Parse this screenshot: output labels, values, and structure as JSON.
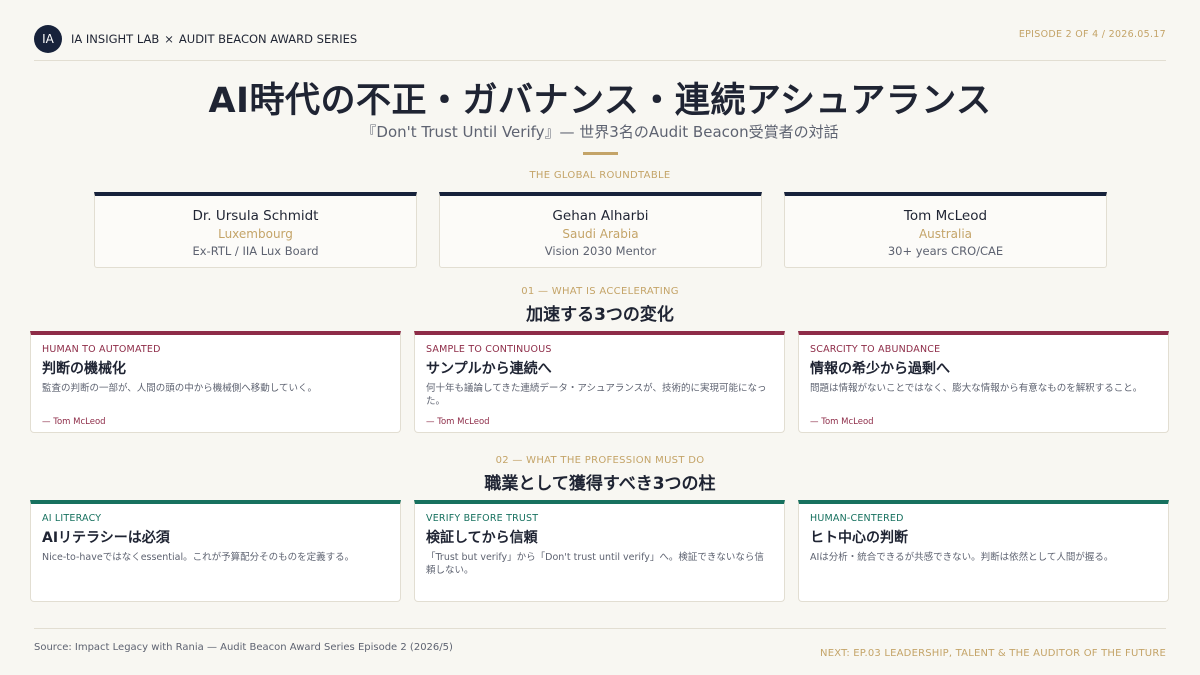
{
  "header": {
    "logo_text": "IA",
    "brand_left": "IA INSIGHT LAB",
    "separator": "×",
    "brand_right": "AUDIT BEACON AWARD SERIES",
    "episode": "EPISODE 2 OF 4  /  2026.05.17"
  },
  "title": {
    "main": "AI時代の不正・ガバナンス・連続アシュアランス",
    "subtitle": "『Don't Trust Until Verify』— 世界3名のAudit Beacon受賞者の対話"
  },
  "roundtable": {
    "eyebrow": "THE GLOBAL ROUNDTABLE",
    "panelists": [
      {
        "name": "Dr. Ursula Schmidt",
        "country": "Luxembourg",
        "role": "Ex-RTL / IIA Lux Board"
      },
      {
        "name": "Gehan Alharbi",
        "country": "Saudi Arabia",
        "role": "Vision 2030 Mentor"
      },
      {
        "name": "Tom McLeod",
        "country": "Australia",
        "role": "30+ years CRO/CAE"
      }
    ]
  },
  "shifts": {
    "eyebrow": "01 — WHAT IS ACCELERATING",
    "heading": "加速する3つの変化",
    "cards": [
      {
        "label": "HUMAN  TO  AUTOMATED",
        "title": "判断の機械化",
        "body": "監査の判断の一部が、人間の頭の中から機械側へ移動していく。",
        "quote": "— Tom McLeod"
      },
      {
        "label": "SAMPLE  TO  CONTINUOUS",
        "title": "サンプルから連続へ",
        "body": "何十年も議論してきた連続データ・アシュアランスが、技術的に実現可能になった。",
        "quote": "— Tom McLeod"
      },
      {
        "label": "SCARCITY  TO  ABUNDANCE",
        "title": "情報の希少から過剰へ",
        "body": "問題は情報がないことではなく、膨大な情報から有意なものを解釈すること。",
        "quote": "— Tom McLeod"
      }
    ]
  },
  "pillars": {
    "eyebrow": "02 — WHAT THE PROFESSION MUST DO",
    "heading": "職業として獲得すべき3つの柱",
    "cards": [
      {
        "label": "AI LITERACY",
        "title": "AIリテラシーは必須",
        "body": "Nice-to-haveではなくessential。これが予算配分そのものを定義する。"
      },
      {
        "label": "VERIFY BEFORE TRUST",
        "title": "検証してから信頼",
        "body": "「Trust but verify」から「Don't trust until verify」へ。検証できないなら信頼しない。"
      },
      {
        "label": "HUMAN-CENTERED",
        "title": "ヒト中心の判断",
        "body": "AIは分析・統合できるが共感できない。判断は依然として人間が握る。"
      }
    ]
  },
  "footer": {
    "source": "Source: Impact Legacy with Rania — Audit Beacon Award Series Episode 2 (2026/5)",
    "next": "NEXT: EP.03  LEADERSHIP, TALENT & THE AUDITOR OF THE FUTURE"
  },
  "colors": {
    "navy": "#17223b",
    "gold": "#c4a468",
    "crimson": "#8e2c48",
    "teal": "#17715f",
    "background": "#f8f7f2"
  }
}
